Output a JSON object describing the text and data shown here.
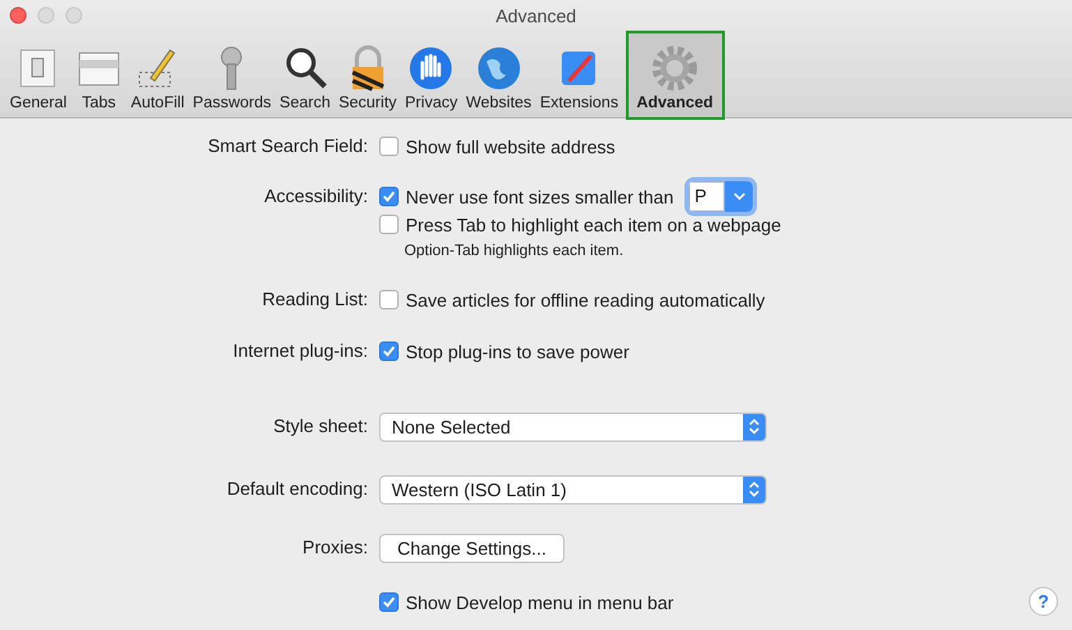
{
  "window": {
    "title": "Advanced"
  },
  "toolbar": [
    {
      "label": "General",
      "selected": false
    },
    {
      "label": "Tabs",
      "selected": false
    },
    {
      "label": "AutoFill",
      "selected": false
    },
    {
      "label": "Passwords",
      "selected": false
    },
    {
      "label": "Search",
      "selected": false
    },
    {
      "label": "Security",
      "selected": false
    },
    {
      "label": "Privacy",
      "selected": false
    },
    {
      "label": "Websites",
      "selected": false
    },
    {
      "label": "Extensions",
      "selected": false
    },
    {
      "label": "Advanced",
      "selected": true
    }
  ],
  "settings": [
    {
      "label": "Smart Search Field:",
      "controls": [
        {
          "kind": "checkbox",
          "text": "Show full website address",
          "checked": false
        }
      ]
    },
    {
      "label": "Accessibility:",
      "controls": [
        {
          "kind": "checkbox",
          "text": "Never use font sizes smaller than",
          "checked": true,
          "combo_value": "P"
        },
        {
          "kind": "checkbox",
          "text": "Press Tab to highlight each item on a webpage",
          "checked": false
        },
        {
          "kind": "note",
          "text": "Option-Tab highlights each item."
        }
      ]
    },
    {
      "label": "Reading List:",
      "controls": [
        {
          "kind": "checkbox",
          "text": "Save articles for offline reading automatically",
          "checked": false
        }
      ]
    },
    {
      "label": "Internet plug-ins:",
      "controls": [
        {
          "kind": "checkbox",
          "text": "Stop plug-ins to save power",
          "checked": true
        }
      ]
    },
    {
      "label": "Style sheet:",
      "controls": [
        {
          "kind": "popup",
          "text": "None Selected"
        }
      ]
    },
    {
      "label": "Default encoding:",
      "controls": [
        {
          "kind": "popup",
          "text": "Western (ISO Latin 1)"
        }
      ]
    },
    {
      "label": "Proxies:",
      "controls": [
        {
          "kind": "button",
          "text": "Change Settings..."
        }
      ]
    },
    {
      "controls": [
        {
          "kind": "checkbox",
          "text": "Show Develop menu in menu bar",
          "checked": true
        }
      ]
    }
  ],
  "help": {
    "text": "?"
  }
}
